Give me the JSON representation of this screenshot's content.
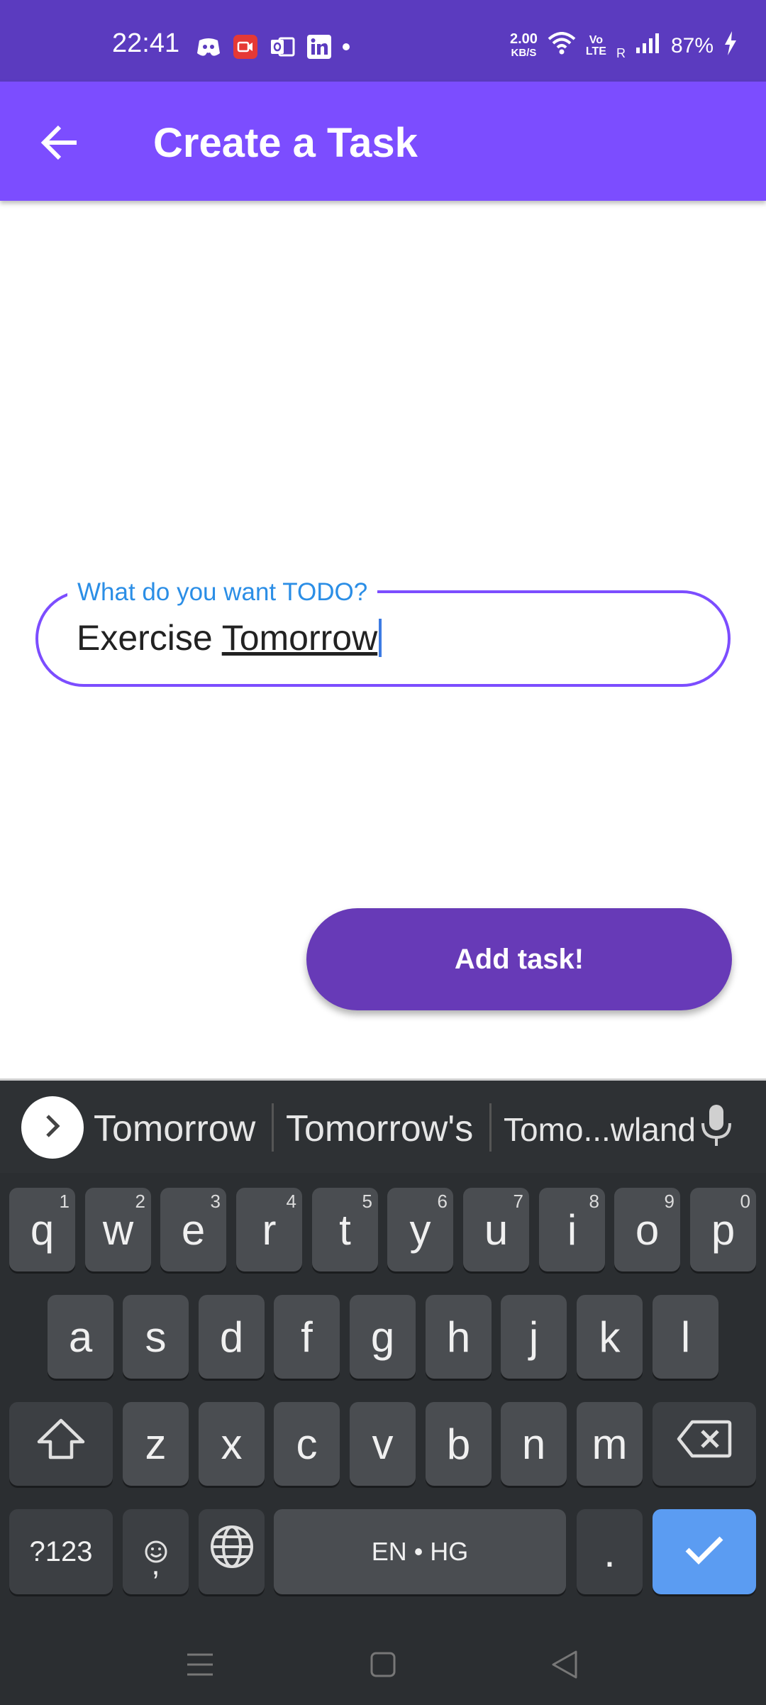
{
  "status_bar": {
    "time": "22:41",
    "net_speed_value": "2.00",
    "net_speed_unit": "KB/S",
    "volte_top": "Vo",
    "volte_bottom": "LTE",
    "roaming": "R",
    "battery": "87%",
    "icons_left": [
      "discord-icon",
      "screen-record-icon",
      "outlook-icon",
      "linkedin-icon",
      "more-dot-icon"
    ],
    "icons_right": [
      "wifi-icon",
      "signal-icon",
      "charging-icon"
    ]
  },
  "app_bar": {
    "title": "Create a Task",
    "back_icon": "arrow-left-icon",
    "color": "#7c4dff"
  },
  "task_field": {
    "label": "What do you want TODO?",
    "value_plain": "Exercise ",
    "value_underlined": "Tomorrow",
    "border_color": "#7c4dff",
    "label_color": "#2b8ee6"
  },
  "add_button": {
    "label": "Add task!",
    "color": "#673ab7"
  },
  "keyboard": {
    "suggestions": [
      "Tomorrow",
      "Tomorrow's",
      "Tomo...wland"
    ],
    "row1": [
      {
        "k": "q",
        "n": "1"
      },
      {
        "k": "w",
        "n": "2"
      },
      {
        "k": "e",
        "n": "3"
      },
      {
        "k": "r",
        "n": "4"
      },
      {
        "k": "t",
        "n": "5"
      },
      {
        "k": "y",
        "n": "6"
      },
      {
        "k": "u",
        "n": "7"
      },
      {
        "k": "i",
        "n": "8"
      },
      {
        "k": "o",
        "n": "9"
      },
      {
        "k": "p",
        "n": "0"
      }
    ],
    "row2": [
      "a",
      "s",
      "d",
      "f",
      "g",
      "h",
      "j",
      "k",
      "l"
    ],
    "row3": [
      "z",
      "x",
      "c",
      "v",
      "b",
      "n",
      "m"
    ],
    "symbols_label": "?123",
    "emoji_comma": ",",
    "space_label": "EN • HG",
    "period": ".",
    "enter_color": "#5b9cf2"
  },
  "nav_bar": {
    "icons": [
      "recent-apps-icon",
      "home-icon",
      "back-triangle-icon"
    ]
  }
}
